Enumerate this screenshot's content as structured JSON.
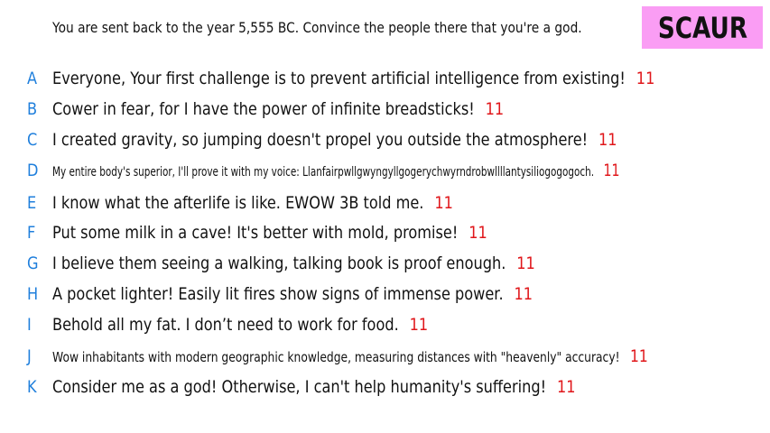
{
  "header": {
    "prompt": "You are sent back to the year 5,555 BC. Convince the people there that you're a god.",
    "title": "SCAUR"
  },
  "colors": {
    "letter": "#1f7fdc",
    "score": "#e0161a",
    "badge": "#fa9df4",
    "text": "#111111"
  },
  "answers": [
    {
      "letter": "A",
      "text": "Everyone, Your first challenge is to prevent artificial intelligence from existing!",
      "score": "11"
    },
    {
      "letter": "B",
      "text": "Cower in fear, for I have the power of infinite breadsticks!",
      "score": "11"
    },
    {
      "letter": "C",
      "text": "I created gravity, so jumping doesn't propel you outside the atmosphere!",
      "score": "11"
    },
    {
      "letter": "D",
      "text": "My entire body's superior, I'll prove it with my voice: Llanfairpwllgwyngyllgogerychwyrndrobwllllantysiliogogogoch.",
      "score": "11"
    },
    {
      "letter": "E",
      "text": "I know what the afterlife is like. EWOW 3B told me.",
      "score": "11"
    },
    {
      "letter": "F",
      "text": "Put some milk in a cave! It's better with mold, promise!",
      "score": "11"
    },
    {
      "letter": "G",
      "text": "I believe them seeing a walking, talking book is proof enough.",
      "score": "11"
    },
    {
      "letter": "H",
      "text": "A pocket lighter! Easily lit fires show signs of immense power.",
      "score": "11"
    },
    {
      "letter": "I",
      "text": "Behold all my fat. I don’t need to work for food.",
      "score": "11"
    },
    {
      "letter": "J",
      "text": "Wow inhabitants with modern geographic knowledge, measuring distances with \"heavenly\" accuracy!",
      "score": "11"
    },
    {
      "letter": "K",
      "text": "Consider me as a god! Otherwise, I can't help humanity's suffering!",
      "score": "11"
    }
  ]
}
